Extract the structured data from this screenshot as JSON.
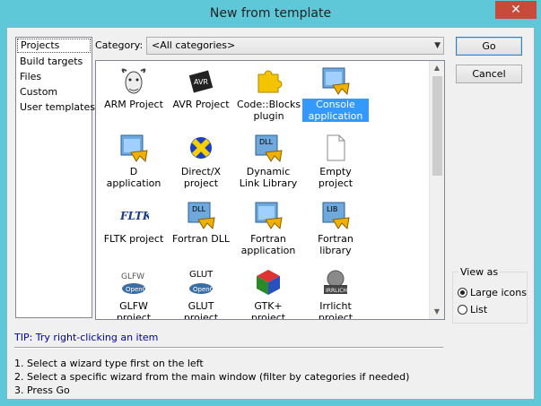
{
  "window": {
    "title": "New from template",
    "close_label": "✕"
  },
  "sidebar": {
    "items": [
      {
        "label": "Projects"
      },
      {
        "label": "Build targets"
      },
      {
        "label": "Files"
      },
      {
        "label": "Custom"
      },
      {
        "label": "User templates"
      }
    ]
  },
  "category": {
    "label": "Category:",
    "value": "<All categories>"
  },
  "buttons": {
    "go": "Go",
    "cancel": "Cancel"
  },
  "templates": [
    {
      "label": "ARM Project",
      "icon": "gnu-icon"
    },
    {
      "label": "AVR Project",
      "icon": "avr-chip-icon"
    },
    {
      "label": "Code::Blocks plugin",
      "icon": "puzzle-icon"
    },
    {
      "label": "Console application",
      "icon": "console-app-icon",
      "selected": true
    },
    {
      "label": "D application",
      "icon": "d-app-icon"
    },
    {
      "label": "Direct/X project",
      "icon": "directx-icon"
    },
    {
      "label": "Dynamic Link Library",
      "icon": "dll-icon"
    },
    {
      "label": "Empty project",
      "icon": "empty-page-icon"
    },
    {
      "label": "FLTK project",
      "icon": "fltk-icon"
    },
    {
      "label": "Fortran DLL",
      "icon": "fortran-dll-icon"
    },
    {
      "label": "Fortran application",
      "icon": "fortran-app-icon"
    },
    {
      "label": "Fortran library",
      "icon": "fortran-lib-icon"
    },
    {
      "label": "GLFW project",
      "icon": "glfw-icon"
    },
    {
      "label": "GLUT project",
      "icon": "glut-icon"
    },
    {
      "label": "GTK+ project",
      "icon": "gtk-icon"
    },
    {
      "label": "Irrlicht project",
      "icon": "irrlicht-icon"
    }
  ],
  "view_as": {
    "label": "View as",
    "options": [
      {
        "label": "Large icons",
        "checked": true
      },
      {
        "label": "List",
        "checked": false
      }
    ]
  },
  "tip": "TIP: Try right-clicking an item",
  "instructions": [
    "1. Select a wizard type first on the left",
    "2. Select a specific wizard from the main window (filter by categories if needed)",
    "3. Press Go"
  ],
  "colors": {
    "selection": "#3399ff",
    "tip": "#0000a0",
    "close": "#c74a3b",
    "frame": "#5fc8d8"
  }
}
